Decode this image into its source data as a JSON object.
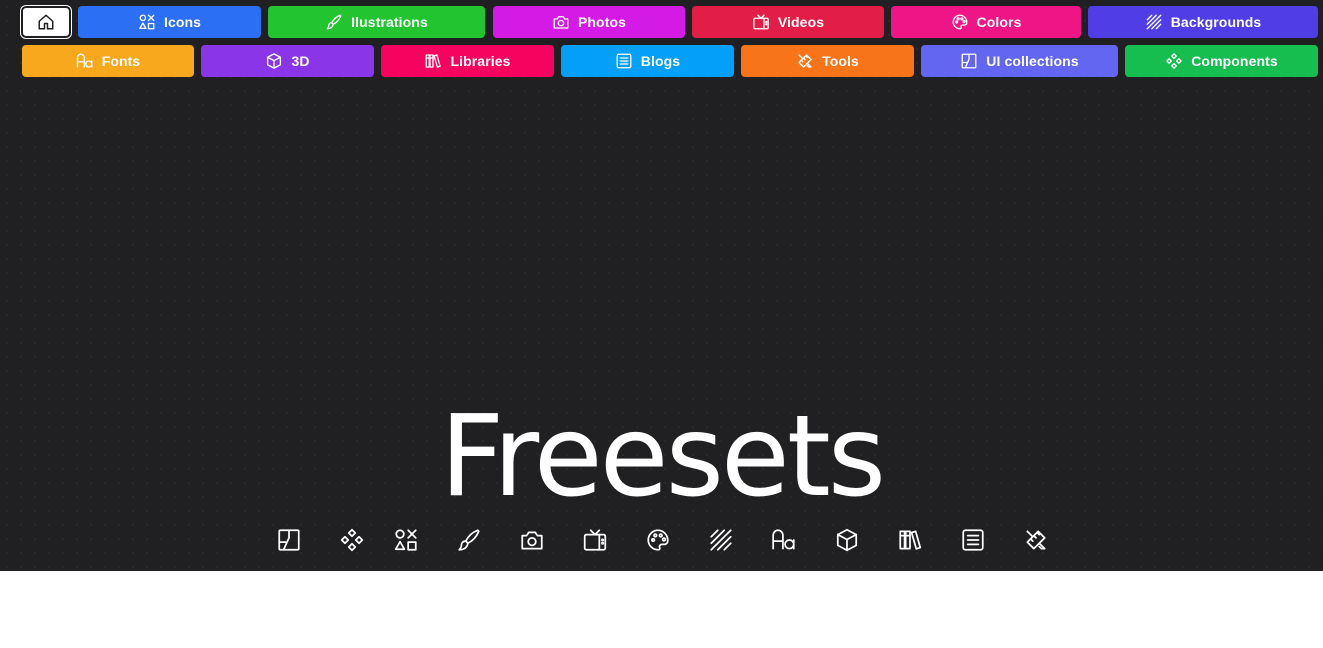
{
  "nav": {
    "home_icon": "home-icon",
    "row1": [
      {
        "label": "Icons",
        "icon": "shapes-icon",
        "color": "#2b6ff5"
      },
      {
        "label": "Ilustrations",
        "icon": "brush-icon",
        "color": "#22c42f"
      },
      {
        "label": "Photos",
        "icon": "camera-icon",
        "color": "#d41be6"
      },
      {
        "label": "Videos",
        "icon": "tv-icon",
        "color": "#e11d48"
      },
      {
        "label": "Colors",
        "icon": "palette-icon",
        "color": "#f01587"
      },
      {
        "label": "Backgrounds",
        "icon": "stripes-icon",
        "color": "#4f3ee6"
      }
    ],
    "row2": [
      {
        "label": "Fonts",
        "icon": "font-icon",
        "color": "#f8a81c"
      },
      {
        "label": "3D",
        "icon": "cube-icon",
        "color": "#8a36e8"
      },
      {
        "label": "Libraries",
        "icon": "books-icon",
        "color": "#f5035e"
      },
      {
        "label": "Blogs",
        "icon": "article-icon",
        "color": "#049ff8"
      },
      {
        "label": "Tools",
        "icon": "tools-icon",
        "color": "#f77518"
      },
      {
        "label": "UI collections",
        "icon": "layout-icon",
        "color": "#6366f1"
      },
      {
        "label": "Components",
        "icon": "components-icon",
        "color": "#16bd4f"
      }
    ]
  },
  "hero": {
    "title": "Freesets"
  },
  "icon_strip": [
    "layout-icon",
    "components-icon",
    "shapes-icon",
    "brush-icon",
    "camera-icon",
    "tv-icon",
    "palette-icon",
    "stripes-icon",
    "font-icon",
    "cube-icon",
    "books-icon",
    "article-icon",
    "tools-icon"
  ],
  "colors": {
    "background": "#202023",
    "text": "#ffffff"
  }
}
